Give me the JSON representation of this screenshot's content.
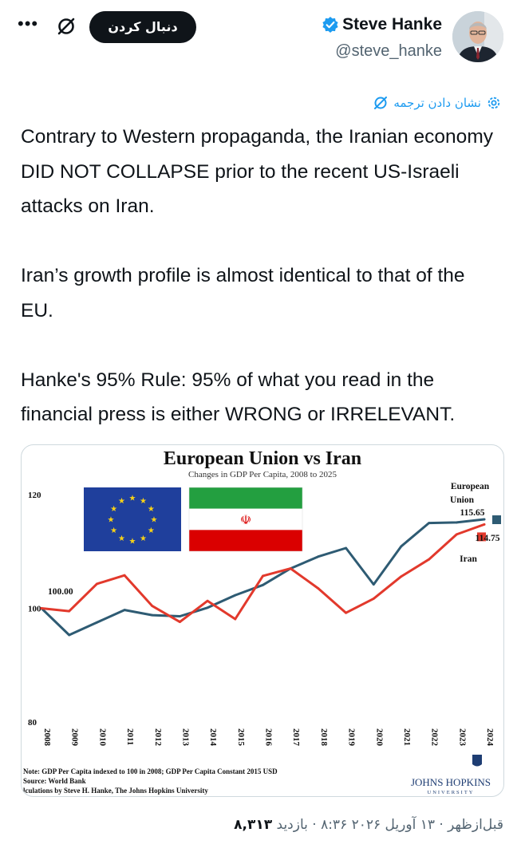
{
  "header": {
    "follow_label": "دنبال کردن",
    "display_name": "Steve Hanke",
    "handle": "@steve_hanke",
    "more_icon": "more-horizontal-icon",
    "grok_icon": "grok-slash-icon",
    "verified_color": "#1d9bf0"
  },
  "translate": {
    "label": "نشان دادن ترجمه"
  },
  "tweet": {
    "paragraphs": [
      "Contrary to Western propaganda, the Iranian economy DID NOT COLLAPSE prior to the recent US-Israeli attacks on Iran.",
      "Iran’s growth profile is almost identical to that of the EU.",
      "Hanke's 95% Rule: 95% of what you read in the financial press is either WRONG or IRRELEVANT."
    ]
  },
  "chart_data": {
    "type": "line",
    "title": "European Union vs Iran",
    "subtitle": "Changes in GDP Per Capita, 2008 to 2025",
    "x": [
      "2008",
      "2009",
      "2010",
      "2011",
      "2012",
      "2013",
      "2014",
      "2015",
      "2016",
      "2017",
      "2018",
      "2019",
      "2020",
      "2021",
      "2022",
      "2023",
      "2024"
    ],
    "ylim": [
      80,
      120
    ],
    "yticks": [
      80,
      100,
      120
    ],
    "series": [
      {
        "name": "European Union",
        "color": "#2e5b73",
        "values": [
          100.0,
          95.3,
          97.5,
          99.7,
          98.8,
          98.6,
          100.1,
          102.3,
          104.1,
          107.0,
          109.1,
          110.6,
          104.2,
          110.9,
          115.0,
          115.1,
          115.65
        ]
      },
      {
        "name": "Iran",
        "color": "#e2392c",
        "values": [
          100.0,
          99.5,
          104.3,
          105.8,
          100.4,
          97.6,
          101.3,
          98.1,
          105.7,
          107.0,
          103.5,
          99.2,
          101.7,
          105.6,
          108.6,
          113.0,
          114.75
        ]
      }
    ],
    "labels": {
      "start": "100.00",
      "eu_name_line1": "European",
      "eu_name_line2": "Union",
      "eu_end": "115.65",
      "iran_end": "114.75",
      "iran_name": "Iran"
    },
    "notes": [
      "Note: GDP Per Capita indexed to 100 in 2008; GDP Per Capita Constant 2015 USD",
      "Source: World Bank",
      "lculations by Steve H. Hanke, The Johns Hopkins University"
    ],
    "logo_text": "JOHNS HOPKINS",
    "logo_sub": "UNIVERSITY",
    "grid": false
  },
  "footer": {
    "time_text": "قبل‌ازظهر · ۱۳ آوریل ۲۰۲۶ ۸:۳۶ · بازدید",
    "views": "۸,۳۱۳"
  }
}
